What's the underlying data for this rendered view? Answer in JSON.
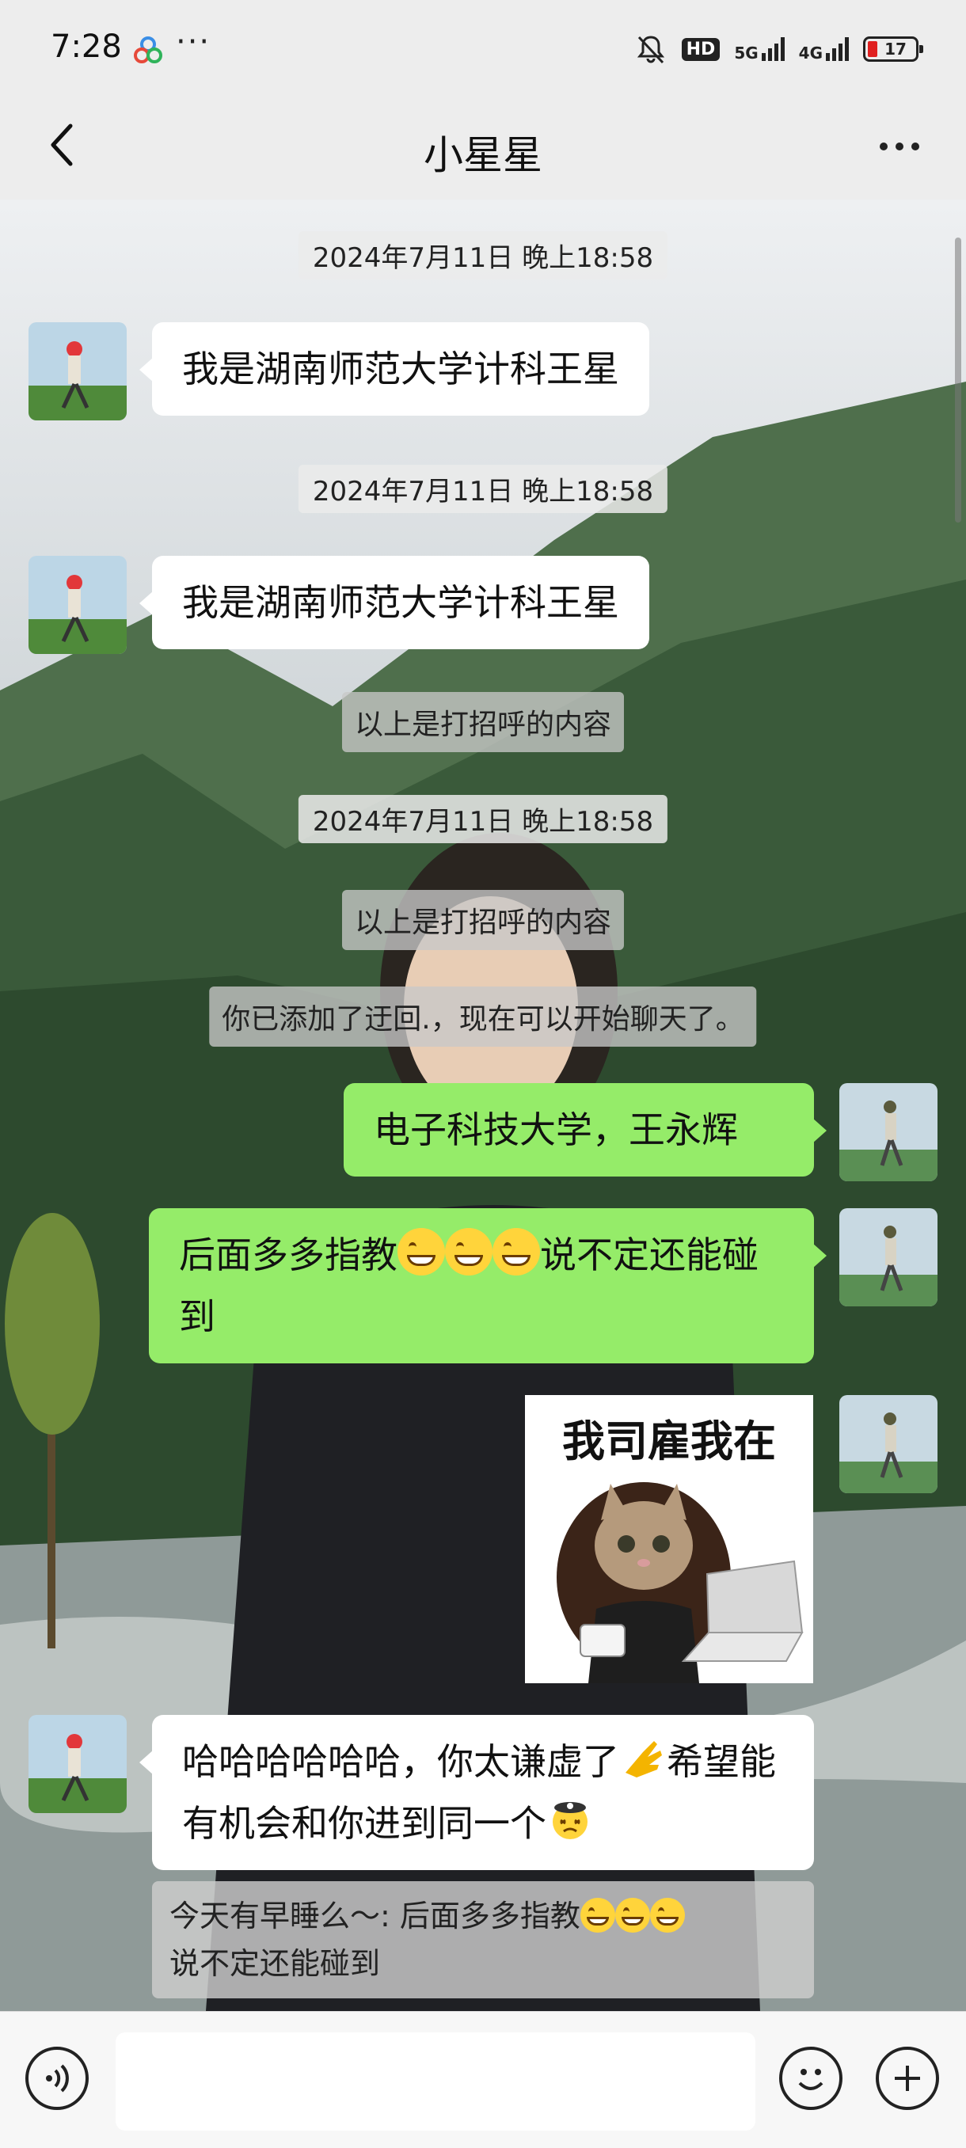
{
  "status_bar": {
    "time": "7:28",
    "dots": "···",
    "hd_label": "HD",
    "net_5g": "5G",
    "net_4g": "4G",
    "battery": "17"
  },
  "header": {
    "title": "小星星"
  },
  "messages": {
    "ts1": "2024年7月11日 晚上18:58",
    "m1": "我是湖南师范大学计科王星",
    "ts2": "2024年7月11日 晚上18:58",
    "m2": "我是湖南师范大学计科王星",
    "sys1": "以上是打招呼的内容",
    "ts3": "2024年7月11日 晚上18:58",
    "sys2": "以上是打招呼的内容",
    "sys3": "你已添加了迂回.，现在可以开始聊天了。",
    "m3": "电子科技大学，王永辉",
    "m4_a": "后面多多指教",
    "m4_b": "说不定还能碰到",
    "sticker_text": "我司雇我在",
    "m5_a": "哈哈哈哈哈哈，你太谦虚了",
    "m5_b": "希望能有机会和你进到同一个",
    "quote_a": "今天有早睡么～: 后面多多指教",
    "quote_b": "说不定还能碰到"
  },
  "input_bar": {
    "placeholder": ""
  },
  "colors": {
    "chat_bubble_self": "#95ec69",
    "chat_bubble_other": "#ffffff",
    "bar_background": "#ededed"
  }
}
